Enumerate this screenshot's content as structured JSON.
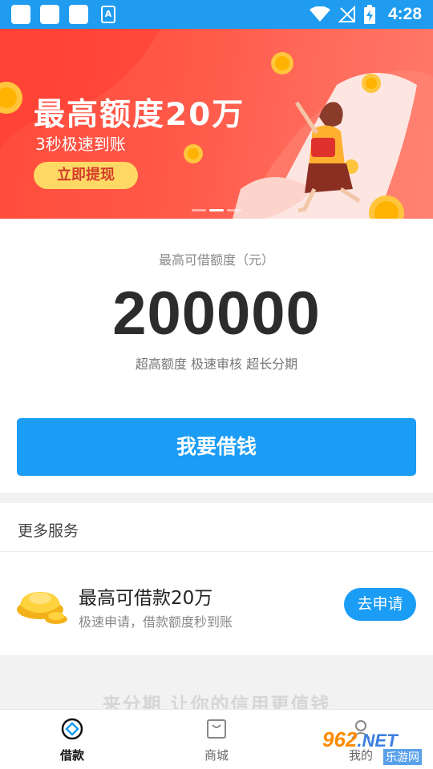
{
  "status_bar": {
    "time": "4:28",
    "app_badge": "A",
    "icons": [
      "notification-square-icon",
      "notification-square-icon",
      "notification-square-icon",
      "app-a-icon",
      "wifi-icon",
      "no-signal-icon",
      "battery-charging-icon"
    ]
  },
  "banner": {
    "title": "最高额度20万",
    "subtitle": "3秒极速到账",
    "button_label": "立即提现",
    "colors": {
      "start": "#ff4a3a",
      "end": "#ff7a6a",
      "button": "#ffd964"
    },
    "pager": {
      "count": 3,
      "active_index": 1
    }
  },
  "credit": {
    "label": "最高可借额度（元）",
    "amount": "200000",
    "description": "超高额度 极速审核 超长分期",
    "button_label": "我要借钱"
  },
  "more_services": {
    "title": "更多服务",
    "items": [
      {
        "icon": "gold-ingot-icon",
        "title": "最高可借款20万",
        "subtitle": "极速申请，借款额度秒到账",
        "action_label": "去申请"
      }
    ]
  },
  "slogan": "来分期 让你的信用更值钱",
  "bottom_nav": {
    "items": [
      {
        "label": "借款",
        "icon": "loan-icon",
        "active": true
      },
      {
        "label": "商城",
        "icon": "shopping-bag-icon",
        "active": false
      },
      {
        "label": "我的",
        "icon": "profile-icon",
        "active": false
      }
    ]
  },
  "watermark": {
    "top": "962",
    "net": ".NET",
    "bottom": "乐游网"
  },
  "accent_color": "#1b9cf5"
}
